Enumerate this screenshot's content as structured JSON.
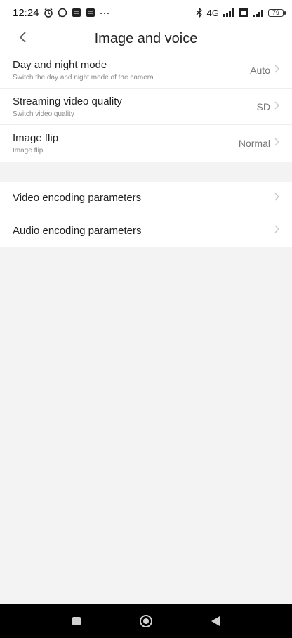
{
  "status_bar": {
    "time": "12:24",
    "left_icons": [
      "alarm-icon",
      "whatsapp-icon",
      "notification-icon",
      "notification-icon"
    ],
    "more": "···",
    "right_icons": [
      "bluetooth-icon",
      "signal-icon",
      "sim-icon",
      "signal-icon"
    ],
    "network": "4G",
    "battery": "79"
  },
  "header": {
    "back_icon": "chevron-left-icon",
    "title": "Image and voice"
  },
  "settings_group_1": [
    {
      "label": "Day and night mode",
      "sublabel": "Switch the day and night mode of the camera",
      "value": "Auto"
    },
    {
      "label": "Streaming video quality",
      "sublabel": "Switch video quality",
      "value": "SD"
    },
    {
      "label": "Image flip",
      "sublabel": "Image flip",
      "value": "Normal"
    }
  ],
  "settings_group_2": [
    {
      "label": "Video encoding parameters"
    },
    {
      "label": "Audio encoding parameters"
    }
  ],
  "colors": {
    "background": "#f3f3f3",
    "card": "#ffffff",
    "navbar": "#000000",
    "chevron": "#c8c8c8"
  }
}
